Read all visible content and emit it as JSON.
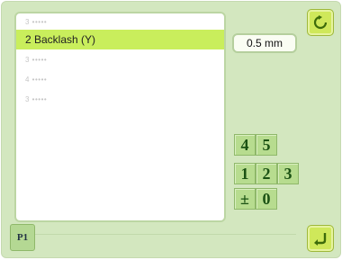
{
  "list": {
    "items": [
      {
        "label": "3 •••••",
        "placeholder": true
      },
      {
        "label": "2 Backlash (Y)",
        "selected": true
      },
      {
        "label": "3 •••••",
        "placeholder": true
      },
      {
        "label": "4 •••••",
        "placeholder": true
      },
      {
        "label": "3 •••••",
        "placeholder": true
      }
    ]
  },
  "value": {
    "text": "0.5 mm"
  },
  "keypad": {
    "k4": "4",
    "k5": "5",
    "k1": "1",
    "k2": "2",
    "k3": "3",
    "kpm": "±",
    "k0": "0"
  },
  "page": {
    "tab_label": "P1"
  },
  "icons": {
    "top": "refresh-icon",
    "bottom": "return-icon"
  },
  "colors": {
    "background": "#d3e7bf",
    "selected_row": "#c9ee5c",
    "button": "#cfe85a",
    "key": "#b7dc8f",
    "key_text": "#1b5214"
  }
}
